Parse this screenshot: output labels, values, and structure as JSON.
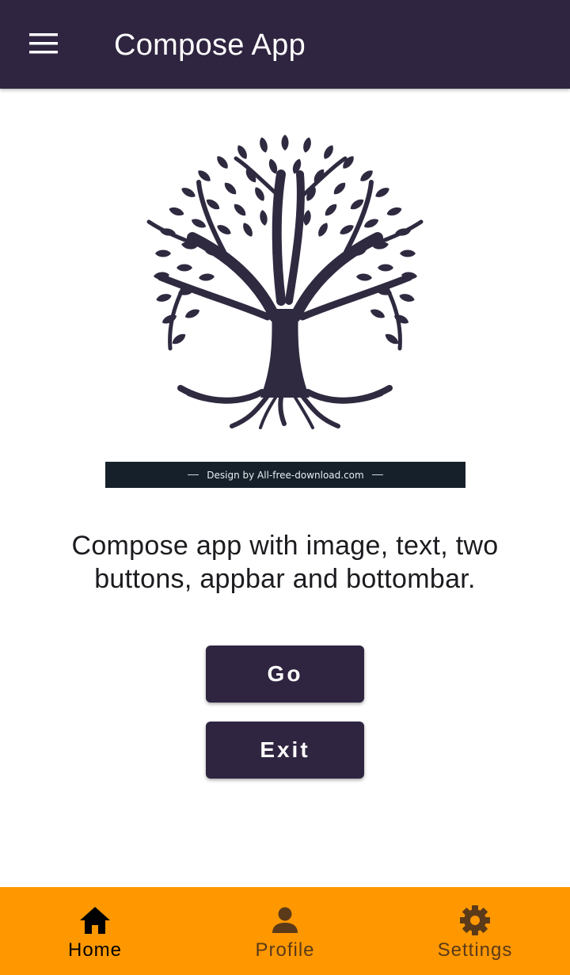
{
  "appbar": {
    "title": "Compose App",
    "background": "#2f2540",
    "menu_icon": "hamburger-menu-icon"
  },
  "hero": {
    "image_description_icon": "tree-of-life-image",
    "credit_text": "Design by All-free-download.com"
  },
  "main": {
    "description": "Compose app with image, text, two buttons, appbar and bottombar."
  },
  "buttons": {
    "go_label": "Go",
    "exit_label": "Exit",
    "color": "#2f2540"
  },
  "bottombar": {
    "background": "#ff9800",
    "items": [
      {
        "label": "Home",
        "icon": "home-icon",
        "active": true
      },
      {
        "label": "Profile",
        "icon": "person-icon",
        "active": false
      },
      {
        "label": "Settings",
        "icon": "gear-icon",
        "active": false
      }
    ]
  }
}
